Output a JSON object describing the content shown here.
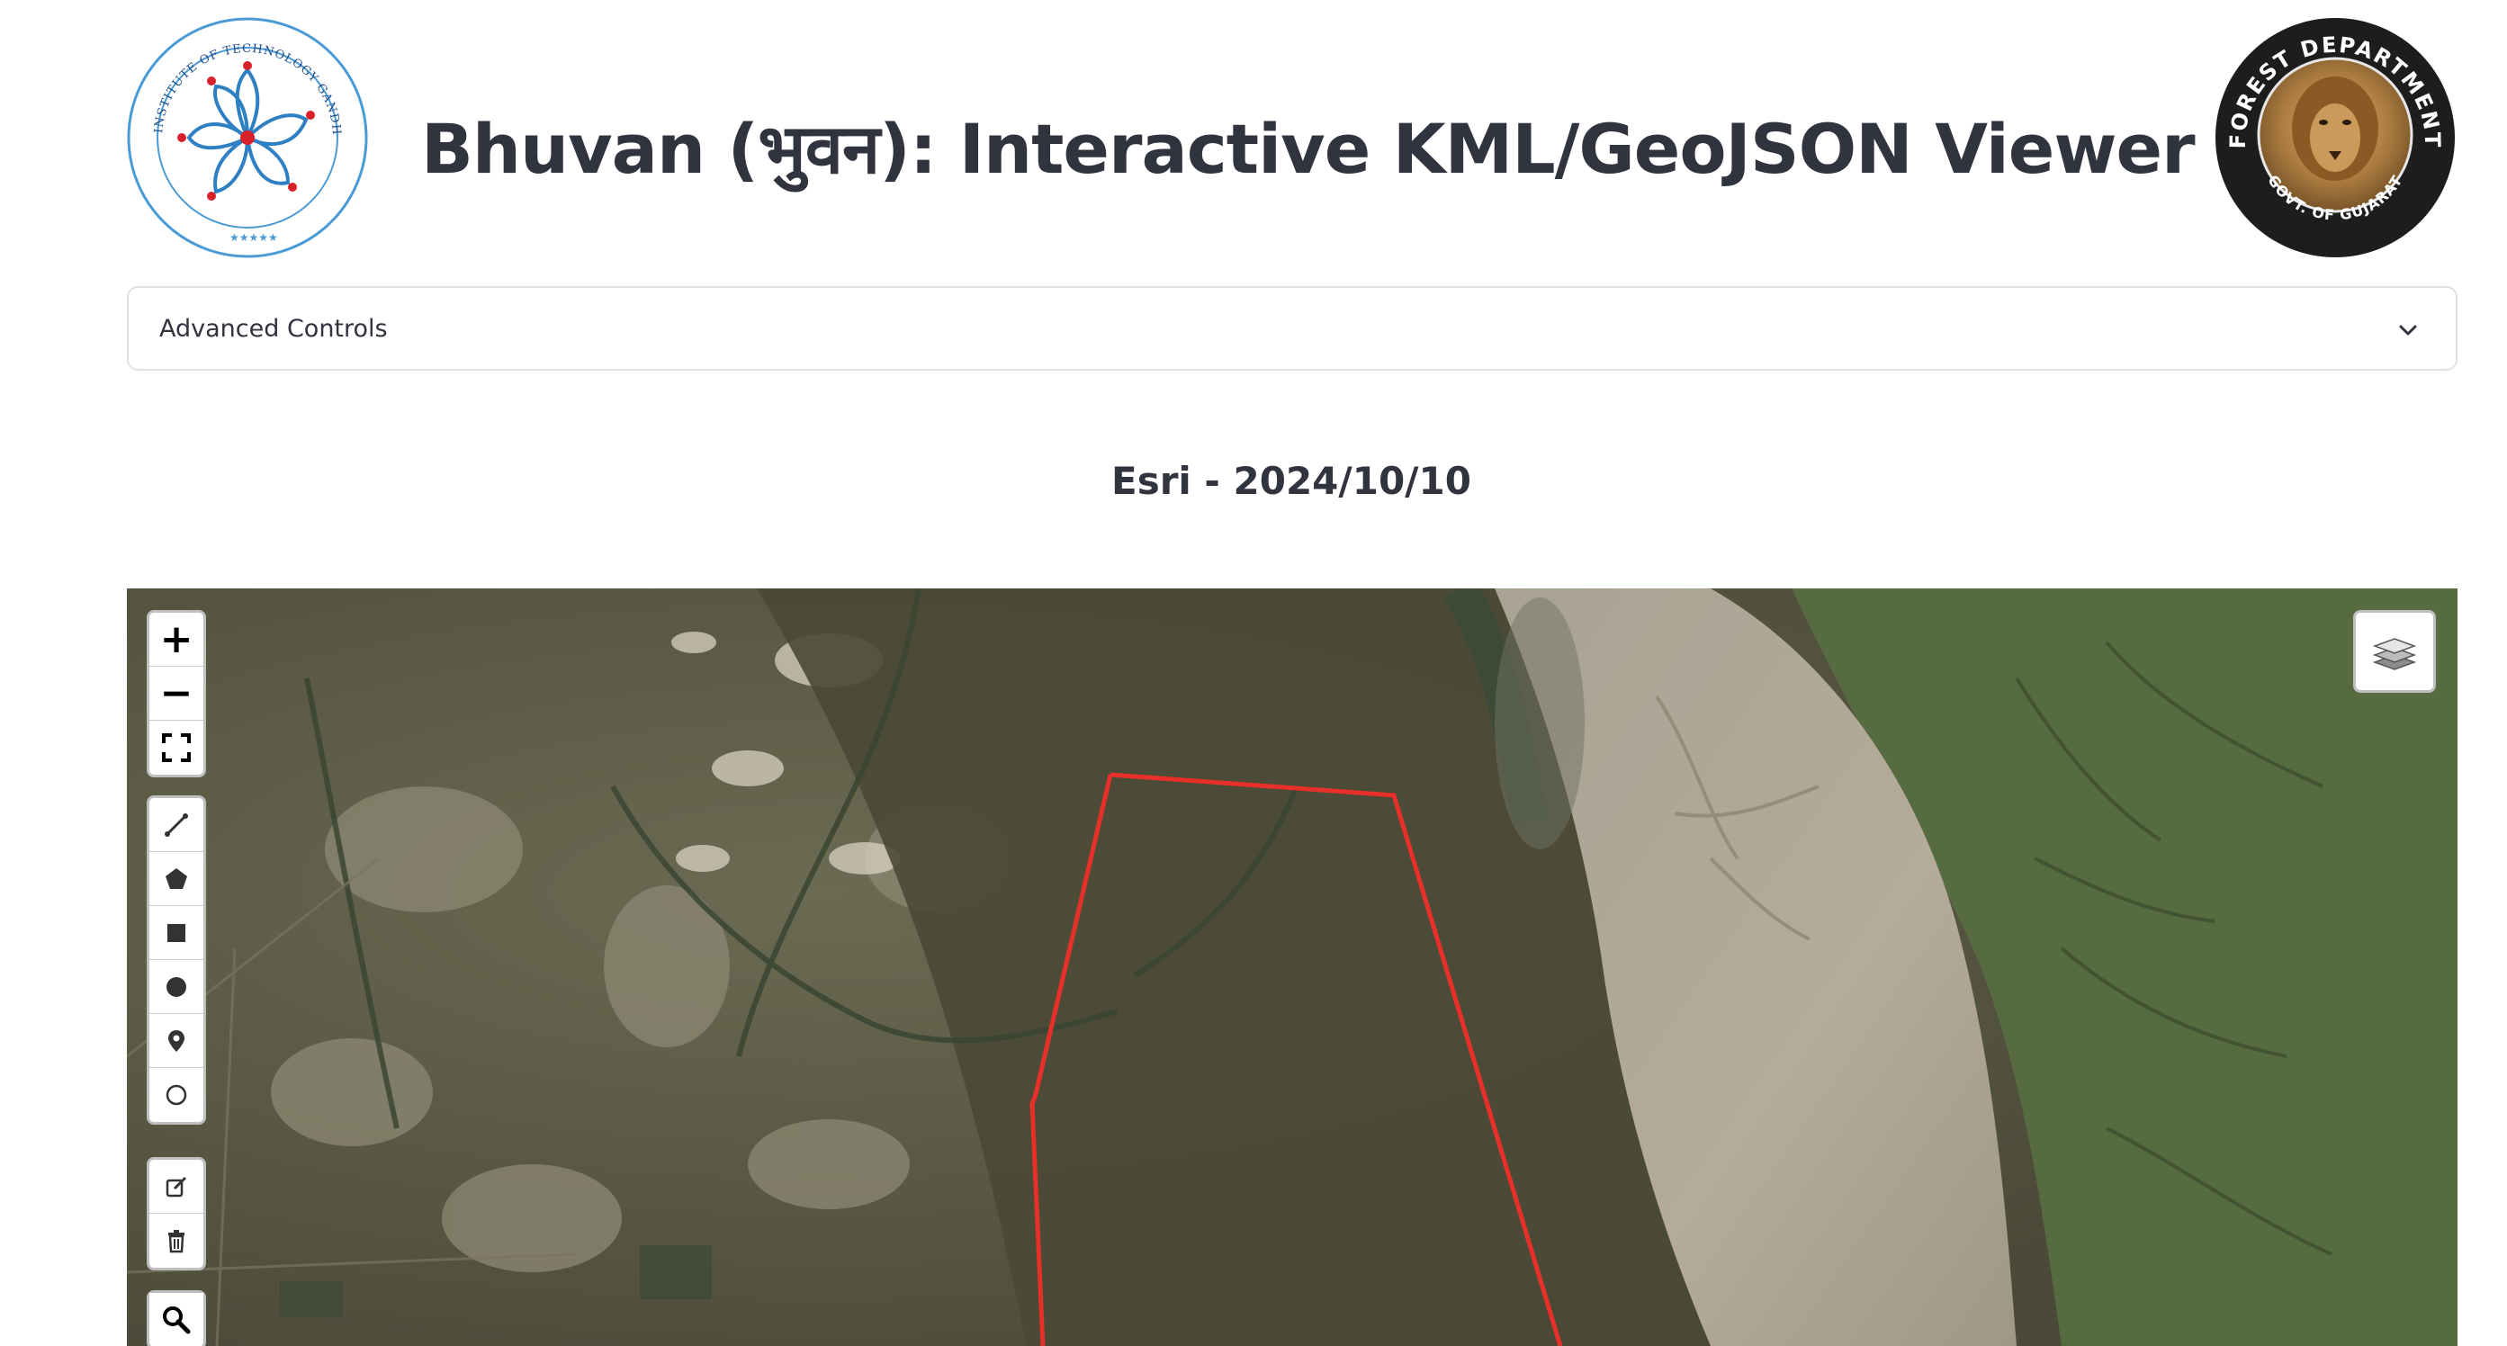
{
  "header": {
    "title": "Bhuvan (भुवन): Interactive KML/GeoJSON Viewer",
    "left_logo_icon": "iit-gandhinagar-logo",
    "left_logo_text": "INDIAN INSTITUTE OF TECHNOLOGY GANDHINAGAR",
    "right_logo_icon": "forest-department-logo",
    "right_logo_top": "FOREST DEPARTMENT",
    "right_logo_bottom": "GOVT. OF GUJARAT"
  },
  "expander": {
    "label": "Advanced Controls",
    "icon": "chevron-down-icon"
  },
  "map": {
    "title": "Esri - 2024/10/10",
    "boundary_color": "#e8302a",
    "zoom_in": "+",
    "zoom_out": "−",
    "controls": {
      "zoom": [
        "zoom-in-button",
        "zoom-out-button",
        "fullscreen-button"
      ],
      "draw": [
        "polyline-icon",
        "polygon-icon",
        "rectangle-icon",
        "circle-icon",
        "marker-icon",
        "circle-marker-icon"
      ],
      "edit": [
        "edit-icon",
        "trash-icon"
      ],
      "search": "search-icon",
      "layers": "layers-icon"
    }
  }
}
